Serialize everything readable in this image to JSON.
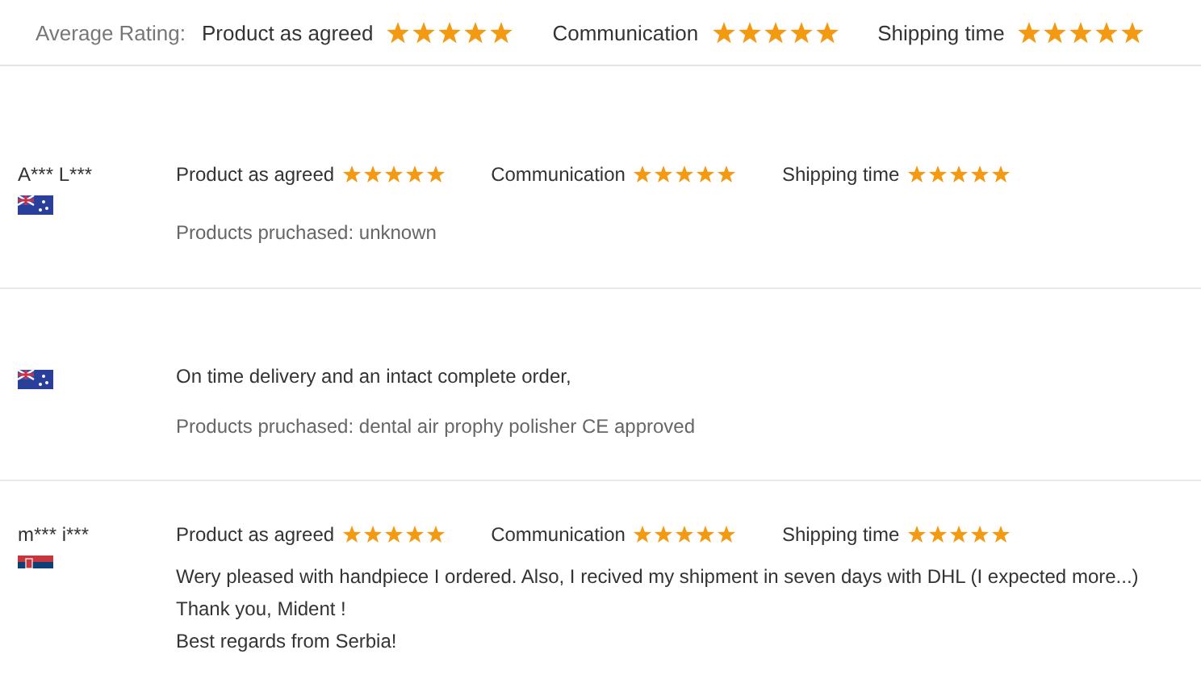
{
  "average_rating": {
    "label": "Average Rating:",
    "ratings": [
      {
        "label": "Product as agreed",
        "stars": 5
      },
      {
        "label": "Communication",
        "stars": 5
      },
      {
        "label": "Shipping time",
        "stars": 5
      }
    ]
  },
  "reviews": [
    {
      "name": "A*** L***",
      "flag": {
        "kind": "australia"
      },
      "ratings": [
        {
          "label": "Product as agreed",
          "stars": 5
        },
        {
          "label": "Communication",
          "stars": 5
        },
        {
          "label": "Shipping time",
          "stars": 5
        }
      ],
      "products": "Products pruchased: unknown"
    },
    {
      "flag": {
        "kind": "australia"
      },
      "comment": [
        "On time delivery and an intact complete order,"
      ],
      "products": "Products pruchased: dental air prophy polisher CE approved"
    },
    {
      "name": "m*** i***",
      "flag": {
        "kind": "serbia"
      },
      "ratings": [
        {
          "label": "Product as agreed",
          "stars": 5
        },
        {
          "label": "Communication",
          "stars": 5
        },
        {
          "label": "Shipping time",
          "stars": 5
        }
      ],
      "comment": [
        "Wery pleased with handpiece I ordered. Also, I recived my shipment in seven days with DHL (I expected more...)",
        "Thank you, Mident !",
        "Best regards from Serbia!"
      ]
    }
  ]
}
